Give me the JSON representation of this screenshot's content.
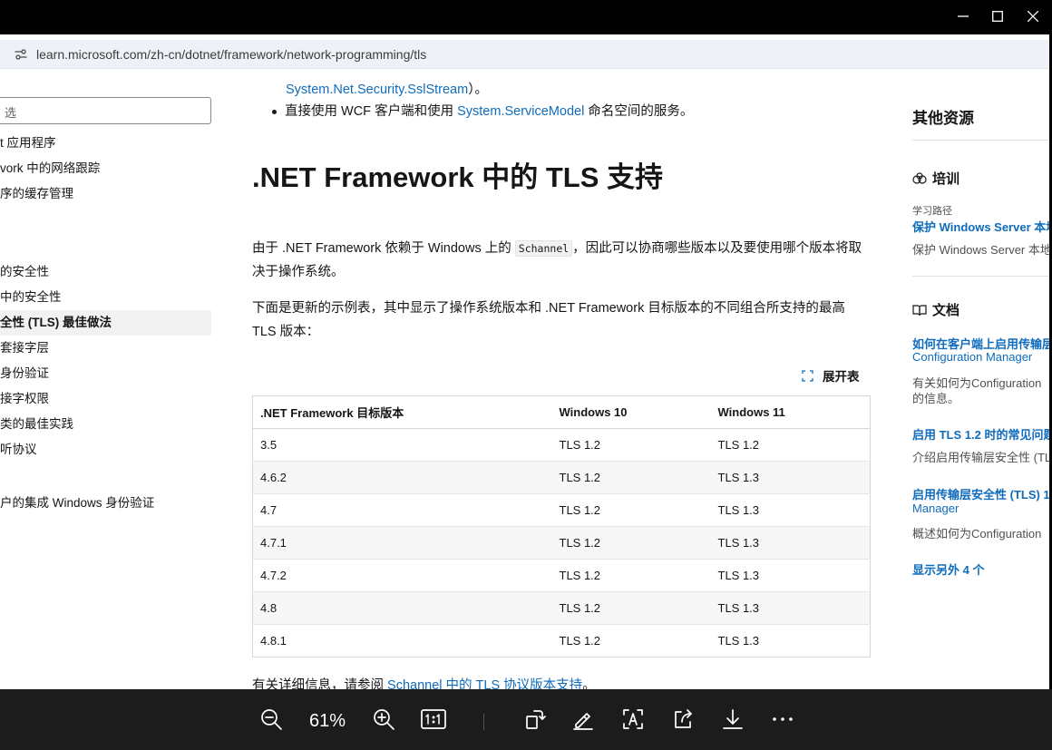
{
  "browser": {
    "url": "learn.microsoft.com/zh-cn/dotnet/framework/network-programming/tls"
  },
  "leftnav": {
    "filter_placeholder": "选",
    "items": [
      {
        "label": "t 应用程序"
      },
      {
        "label": "vork 中的网络跟踪"
      },
      {
        "label": "序的缓存管理"
      },
      {
        "label": "的安全性"
      },
      {
        "label": "中的安全性"
      },
      {
        "label": "全性 (TLS) 最佳做法",
        "active": true
      },
      {
        "label": "套接字层"
      },
      {
        "label": "身份验证"
      },
      {
        "label": "接字权限"
      },
      {
        "label": "类的最佳实践"
      },
      {
        "label": "听协议"
      },
      {
        "label": "户的集成 Windows 身份验证"
      }
    ]
  },
  "main": {
    "intro_link": "System.Net.Security.SslStream",
    "intro_tail": "）。",
    "bullet_pre": "直接使用 WCF 客户端和使用 ",
    "bullet_link": "System.ServiceModel",
    "bullet_post": " 命名空间的服务。",
    "heading": ".NET Framework 中的 TLS 支持",
    "para1_pre": "由于 .NET Framework 依赖于 Windows 上的 ",
    "para1_code": "Schannel",
    "para1_post": "，因此可以协商哪些版本以及要使用哪个版本将取决于操作系统。",
    "para2": "下面是更新的示例表，其中显示了操作系统版本和 .NET Framework 目标版本的不同组合所支持的最高 TLS 版本：",
    "expand_label": "展开表",
    "table": {
      "headers": [
        ".NET Framework 目标版本",
        "Windows 10",
        "Windows 11"
      ],
      "rows": [
        [
          "3.5",
          "TLS 1.2",
          "TLS 1.2"
        ],
        [
          "4.6.2",
          "TLS 1.2",
          "TLS 1.3"
        ],
        [
          "4.7",
          "TLS 1.2",
          "TLS 1.3"
        ],
        [
          "4.7.1",
          "TLS 1.2",
          "TLS 1.3"
        ],
        [
          "4.7.2",
          "TLS 1.2",
          "TLS 1.3"
        ],
        [
          "4.8",
          "TLS 1.2",
          "TLS 1.3"
        ],
        [
          "4.8.1",
          "TLS 1.2",
          "TLS 1.3"
        ]
      ]
    },
    "more_info_pre": "有关详细信息，请参阅 ",
    "more_info_link": "Schannel 中的 TLS 协议版本支持",
    "more_info_post": "。"
  },
  "rightrail": {
    "title": "其他资源",
    "training": {
      "heading": "培训",
      "kind": "学习路径",
      "link": "保护 Windows Server 本地",
      "desc": "保护 Windows Server 本地"
    },
    "docs": {
      "heading": "文档",
      "items": [
        {
          "link1": "如何在客户端上启用传输层",
          "link2": "Configuration Manager",
          "desc1": "有关如何为Configuration",
          "desc2": "的信息。"
        },
        {
          "link1": "启用 TLS 1.2 时的常见问题",
          "desc1": "介绍启用传输层安全性 (TL"
        },
        {
          "link1": "启用传输层安全性 (TLS) 1.",
          "link2": "Manager",
          "desc1": "概述如何为Configuration"
        }
      ],
      "show_more": "显示另外 4 个"
    }
  },
  "viewer": {
    "zoom": "61%",
    "icons": [
      "zoom-out-icon",
      "zoom-in-icon",
      "actual-size-icon",
      "rotate-icon",
      "edit-icon",
      "text-select-icon",
      "share-icon",
      "download-icon",
      "more-icon"
    ]
  }
}
